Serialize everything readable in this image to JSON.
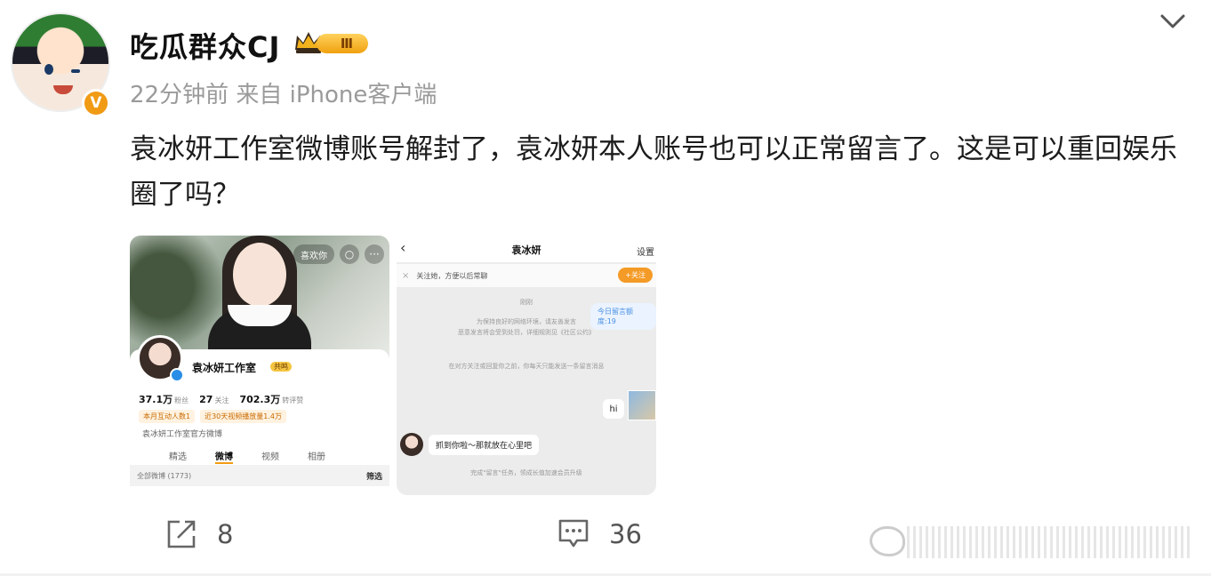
{
  "post": {
    "username": "吃瓜群众CJ",
    "level_badge": "Ⅲ",
    "verified_badge": "V",
    "meta": "22分钟前 来自 iPhone客户端",
    "text": "袁冰妍工作室微博账号解封了，袁冰妍本人账号也可以正常留言了。这是可以重回娱乐圈了吗？"
  },
  "profile_screenshot": {
    "top_pill": "喜欢你",
    "name": "袁冰妍工作室",
    "tag": "共鸣",
    "stats": [
      {
        "value": "37.1万",
        "label": "粉丝"
      },
      {
        "value": "27",
        "label": "关注"
      },
      {
        "value": "702.3万",
        "label": "转评赞"
      }
    ],
    "tags": [
      "本月互动人数1",
      "近30天视频播放量1.4万"
    ],
    "description": "袁冰妍工作室官方微博",
    "tabs": [
      "精选",
      "微博",
      "视频",
      "相册"
    ],
    "active_tab": "微博",
    "bar_left": "全部微博 (1773)",
    "bar_right": "筛选"
  },
  "chat_screenshot": {
    "title": "袁冰妍",
    "settings": "设置",
    "follow_prompt": "关注她，方便以后常聊",
    "follow_button": "+关注",
    "time_label": "刚刚",
    "notice_line1": "为保持良好的网络环境，请友善发言",
    "notice_line2": "恶意发言将会受到处罚，详细规则见《社区公约》",
    "quota_bubble": "今日留言额度:19",
    "limit_notice": "在对方关注或回复你之前，你每天只能发送一条留言消息",
    "my_message": "hi",
    "reply": "抓到你啦～那就放在心里吧",
    "footer": "完成\"留言\"任务，领成长值加速会员升级"
  },
  "actions": {
    "share_count": "8",
    "comment_count": "36"
  },
  "colors": {
    "accent": "#f19a14",
    "text": "#1c1c1c",
    "meta": "#9a9a9a"
  }
}
